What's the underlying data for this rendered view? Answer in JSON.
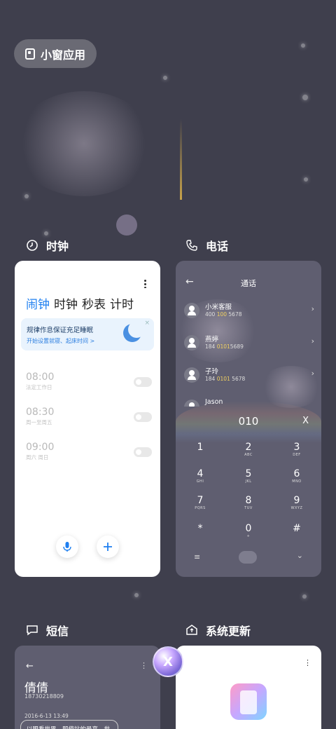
{
  "top_pill": {
    "label": "小窗应用",
    "icon": "small-window-icon"
  },
  "apps": [
    {
      "title": "时钟",
      "icon": "clock-icon"
    },
    {
      "title": "电话",
      "icon": "phone-icon"
    },
    {
      "title": "短信",
      "icon": "message-icon"
    },
    {
      "title": "系统更新",
      "icon": "update-icon"
    }
  ],
  "clock": {
    "tabs": [
      "闹钟",
      "时钟",
      "秒表",
      "计时"
    ],
    "active_tab": "闹钟",
    "banner": {
      "title": "规律作息保证充足睡眠",
      "subtitle": "开始设置就寝、起床时间 >"
    },
    "alarms": [
      {
        "time": "08:00",
        "days": "法定工作日"
      },
      {
        "time": "08:30",
        "days": "周一至周五"
      },
      {
        "time": "09:00",
        "days": "周六 周日"
      }
    ]
  },
  "phone": {
    "title": "通话",
    "contacts": [
      {
        "name": "小米客服",
        "num_pre": "400 ",
        "num_hl": "100",
        "num_post": " 5678"
      },
      {
        "name": "燕婷",
        "num_pre": "184 ",
        "num_hl": "0101",
        "num_post": "5689"
      },
      {
        "name": "子玲",
        "num_pre": "184 ",
        "num_hl": "0101",
        "num_post": " 5678"
      },
      {
        "name": "Jason",
        "num_pre": "",
        "num_hl": "",
        "num_post": ""
      }
    ],
    "dial_input": "010",
    "keys": [
      {
        "d": "1",
        "l": ""
      },
      {
        "d": "2",
        "l": "ABC"
      },
      {
        "d": "3",
        "l": "DEF"
      },
      {
        "d": "4",
        "l": "GHI"
      },
      {
        "d": "5",
        "l": "JKL"
      },
      {
        "d": "6",
        "l": "MNO"
      },
      {
        "d": "7",
        "l": "PQRS"
      },
      {
        "d": "8",
        "l": "TUV"
      },
      {
        "d": "9",
        "l": "WXYZ"
      },
      {
        "d": "*",
        "l": ""
      },
      {
        "d": "0",
        "l": "+"
      },
      {
        "d": "#",
        "l": ""
      }
    ]
  },
  "sms": {
    "contact_name": "倩倩",
    "number": "18730218809",
    "date": "2016-6-13 13:49",
    "message_preview": "以眼看世界，即使站的最高，世界"
  },
  "close_label": "X"
}
